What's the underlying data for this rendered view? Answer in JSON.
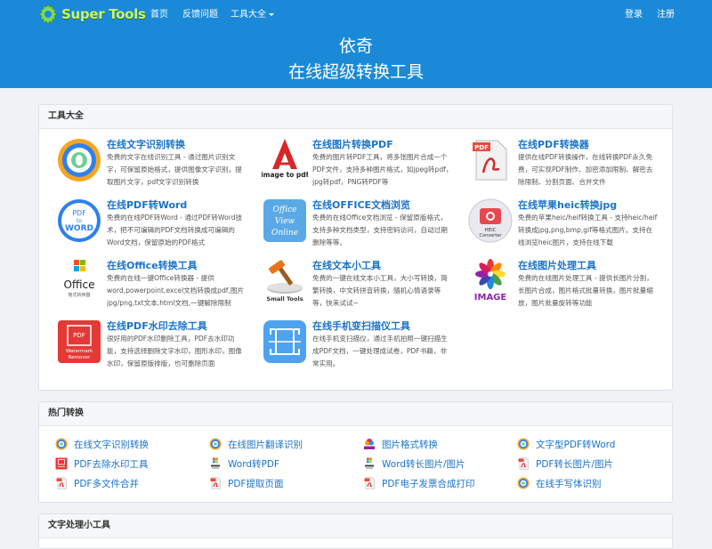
{
  "navbar": {
    "brand": "Super Tools",
    "home": "首页",
    "feedback": "反馈问题",
    "tools_menu": "工具大全",
    "login": "登录",
    "register": "注册"
  },
  "hero": {
    "title": "依奇",
    "subtitle": "在线超级转换工具"
  },
  "tools_panel": {
    "heading": "工具大全",
    "items": [
      {
        "title": "在线文字识别转换",
        "desc": "免费的文字在线识别工具 - 通过图片识别文字，可保留原始格式，提供图像文字识别，提取图片文字，pdf文字识别转换"
      },
      {
        "title": "在线图片转换PDF",
        "desc": "免费的图片转PDF工具，将多张图片合成一个PDF文件，支持多种图片格式，如jpeg转pdf，jpg转pdf，PNG转PDF等"
      },
      {
        "title": "在线PDF转换器",
        "desc": "提供在线PDF转换操作，在线转换PDF永久免费，可实现PDF制作、加密添加限制、解密去除限制、分割页面、合并文件"
      },
      {
        "title": "在线PDF转Word",
        "desc": "免费的在线PDF转Word - 通过PDF转Word技术，把不可编辑的PDF文档转换成可编辑的Word文档，保留原始的PDF格式"
      },
      {
        "title": "在线OFFICE文档浏览",
        "desc": "免费的在线Office文档浏览 - 保留原版格式，支持多种文档类型，支持密码访问，自动过期删除等等。"
      },
      {
        "title": "在线苹果heic转换jpg",
        "desc": "免费的苹果heic/heif转换工具 - 支持heic/heif转换成jpg,png,bmp,gif等格式图片。支持在线浏览heic图片，支持在线下载"
      },
      {
        "title": "在线Office转换工具",
        "desc": "免费的在线一键Office转换器 - 提供word,powerpoint,excel文档转换成pdf,图片jpg/png,txt文本,html文档,一键解除限制"
      },
      {
        "title": "在线文本小工具",
        "desc": "免费的一键在线文本小工具，大小写转换，简繁转换，中文转拼音转换，随机心情语录等等，快来试试~"
      },
      {
        "title": "在线图片处理工具",
        "desc": "免费的在线图片处理工具 - 提供长图片分割，长图片合成，图片格式批量转换，图片批量缩放，图片批量旋转等功能"
      },
      {
        "title": "在线PDF水印去除工具",
        "desc": "很好用的PDF水印删除工具，PDF去水印功能，支持选择删除文字水印，图形水印，图像水印，保留原版排版，也可删除页面"
      },
      {
        "title": "在线手机变扫描仪工具",
        "desc": "在线手机变扫描仪，通过手机拍照一键扫描生成PDF文档，一键处理成试卷，PDF书籍，非常实用。"
      }
    ]
  },
  "icon_labels": {
    "image_to_pdf": "image to pdf",
    "pdf": "PDF",
    "pdf_to": "PDF",
    "to": "to",
    "word": "WORD",
    "office_view_1": "Office",
    "office_view_2": "View",
    "office_view_3": "Online",
    "heic_1": "HEIC",
    "heic_2": "Converter",
    "office": "Office",
    "office_sub": "格式转换器",
    "small_tools": "Small Tools",
    "image": "IMAGE",
    "wm_1": "PDF",
    "wm_2": "Watermark",
    "wm_3": "Remover"
  },
  "hot_panel": {
    "heading": "热门转换",
    "items": [
      {
        "label": "在线文字识别转换",
        "icon": "ocr-icon"
      },
      {
        "label": "在线图片翻译识别",
        "icon": "ocr-icon"
      },
      {
        "label": "图片格式转换",
        "icon": "image-icon"
      },
      {
        "label": "文字型PDF转Word",
        "icon": "ocr-icon"
      },
      {
        "label": "PDF去除水印工具",
        "icon": "watermark-icon"
      },
      {
        "label": "Word转PDF",
        "icon": "office-icon"
      },
      {
        "label": "Word转长图片/图片",
        "icon": "office-icon"
      },
      {
        "label": "PDF转长图片/图片",
        "icon": "pdf-icon"
      },
      {
        "label": "PDF多文件合并",
        "icon": "pdf-icon"
      },
      {
        "label": "PDF提取页面",
        "icon": "pdf-icon"
      },
      {
        "label": "PDF电子发票合成打印",
        "icon": "pdf-icon"
      },
      {
        "label": "在线手写体识别",
        "icon": "ocr-icon"
      }
    ]
  },
  "text_panel": {
    "heading": "文字处理小工具"
  },
  "colors": {
    "nav_bg": "#1a8ad8",
    "link": "#1a73c9",
    "page_bg": "#f0f2f5"
  }
}
